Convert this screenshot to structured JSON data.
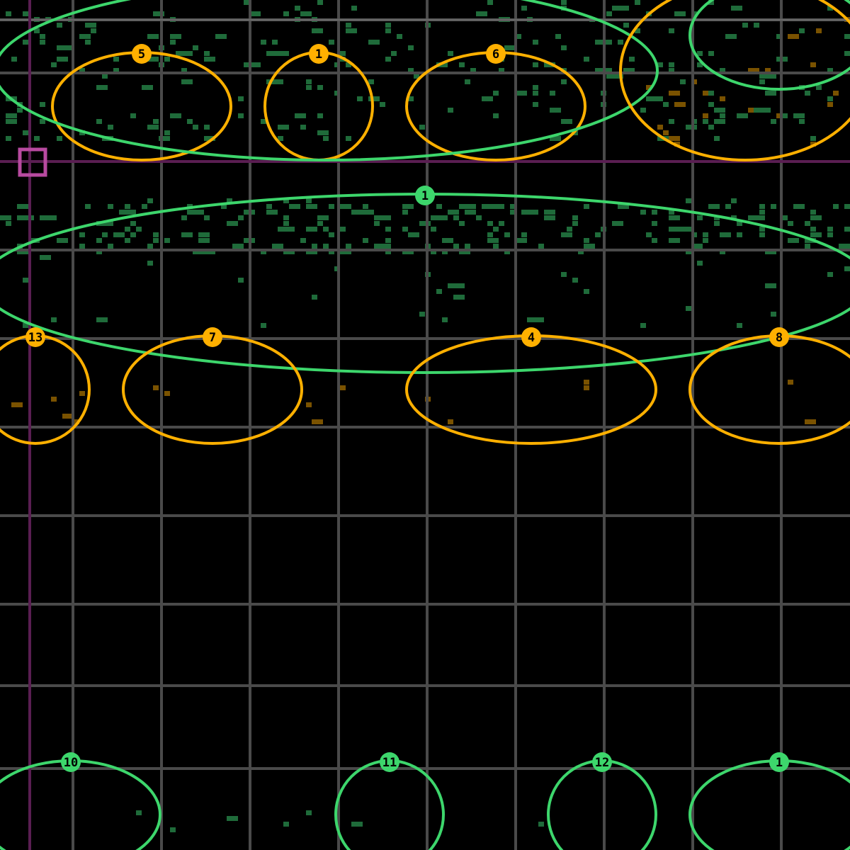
{
  "colors": {
    "background": "#000000",
    "grid": "#4a4a4a",
    "grid_bright": "#7a7a7a",
    "green_ring": "#3dd66c",
    "orange_ring": "#ffb000",
    "magenta": "#b84aa0",
    "magenta_line": "#5a1e52",
    "green_dots": "#1f6b3a",
    "orange_dots": "#7a5200"
  },
  "icons": {
    "cursor": "cursor-selection-square-icon"
  },
  "rings": [
    {
      "id": "ring-5",
      "label": "5",
      "color": "orange"
    },
    {
      "id": "ring-1a",
      "label": "1",
      "color": "orange"
    },
    {
      "id": "ring-6",
      "label": "6",
      "color": "orange"
    },
    {
      "id": "ring-big-top",
      "label": "",
      "color": "green"
    },
    {
      "id": "ring-top-right-orange",
      "label": "",
      "color": "orange"
    },
    {
      "id": "ring-top-right-green",
      "label": "",
      "color": "green"
    },
    {
      "id": "ring-1-main",
      "label": "1",
      "color": "green"
    },
    {
      "id": "ring-13",
      "label": "13",
      "color": "orange"
    },
    {
      "id": "ring-7",
      "label": "7",
      "color": "orange"
    },
    {
      "id": "ring-4",
      "label": "4",
      "color": "orange"
    },
    {
      "id": "ring-8",
      "label": "8",
      "color": "orange"
    },
    {
      "id": "ring-10",
      "label": "10",
      "color": "green"
    },
    {
      "id": "ring-11",
      "label": "11",
      "color": "green"
    },
    {
      "id": "ring-12",
      "label": "12",
      "color": "green"
    },
    {
      "id": "ring-14",
      "label": "1",
      "color": "green"
    }
  ]
}
